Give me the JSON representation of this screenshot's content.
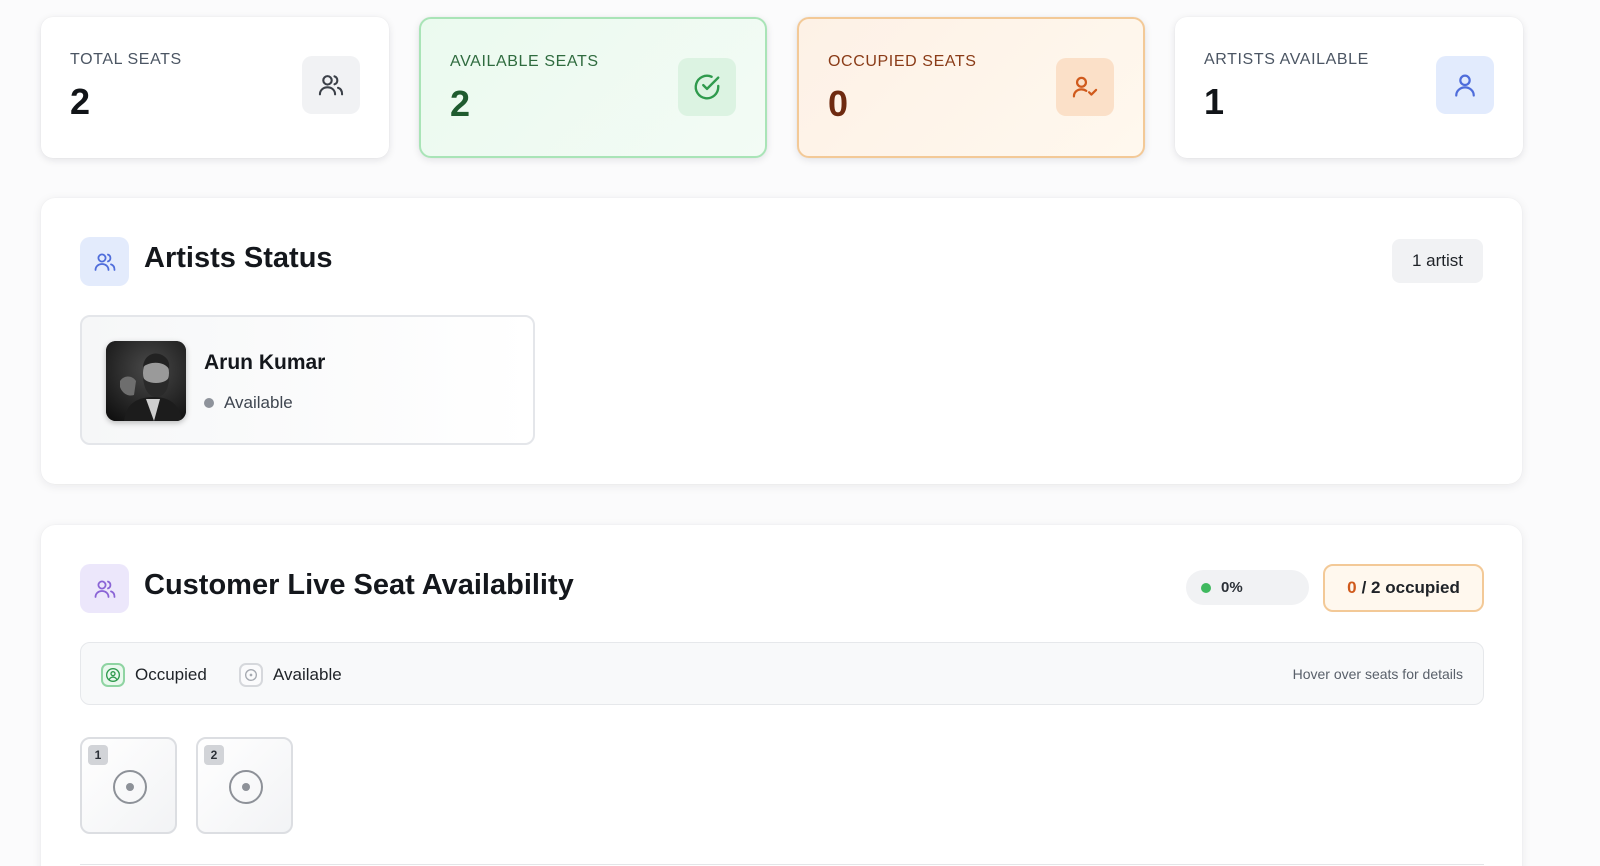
{
  "stats": [
    {
      "label": "TOTAL SEATS",
      "value": "2",
      "icon": "users-icon"
    },
    {
      "label": "AVAILABLE SEATS",
      "value": "2",
      "icon": "check-circle-icon"
    },
    {
      "label": "OCCUPIED SEATS",
      "value": "0",
      "icon": "user-check-icon"
    },
    {
      "label": "ARTISTS AVAILABLE",
      "value": "1",
      "icon": "user-icon"
    }
  ],
  "artists_panel": {
    "title": "Artists Status",
    "count_label": "1 artist",
    "artists": [
      {
        "name": "Arun Kumar",
        "status": "Available"
      }
    ]
  },
  "seats_panel": {
    "title": "Customer Live Seat Availability",
    "percent": "0%",
    "occupied_count": "0",
    "occupied_suffix": "/ 2 occupied",
    "legend": {
      "occupied": "Occupied",
      "available": "Available",
      "hint": "Hover over seats for details"
    },
    "seats": [
      {
        "number": "1",
        "state": "available"
      },
      {
        "number": "2",
        "state": "available"
      }
    ]
  },
  "colors": {
    "available_accent": "#3fb95f",
    "occupied_accent": "#d05a1c",
    "artist_accent": "#4f6ddb",
    "customer_accent": "#8a64d6"
  }
}
